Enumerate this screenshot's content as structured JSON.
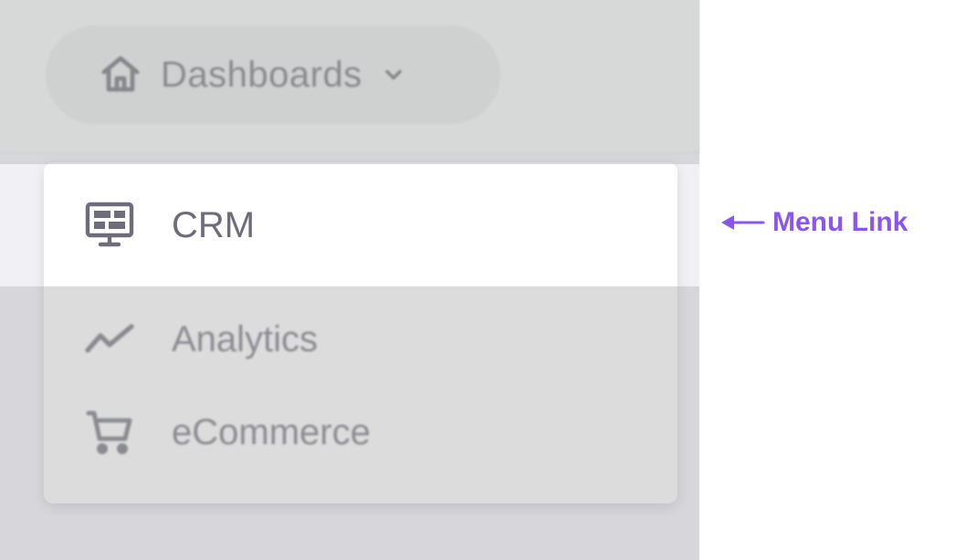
{
  "navbar": {
    "dashboards_label": "Dashboards",
    "home_icon": "home-icon",
    "chevron_icon": "chevron-down-icon"
  },
  "menu": {
    "items": [
      {
        "label": "CRM",
        "icon": "monitor-icon",
        "active": true
      },
      {
        "label": "Analytics",
        "icon": "trending-up-icon",
        "active": false
      },
      {
        "label": "eCommerce",
        "icon": "shopping-cart-icon",
        "active": false
      }
    ]
  },
  "annotation": {
    "label": "Menu Link",
    "icon": "arrow-left-icon"
  },
  "colors": {
    "accent": "#8b55ee",
    "text_active": "#6e6b7b",
    "text_dim": "#8c8c94",
    "overlay": "#d6d6db"
  }
}
